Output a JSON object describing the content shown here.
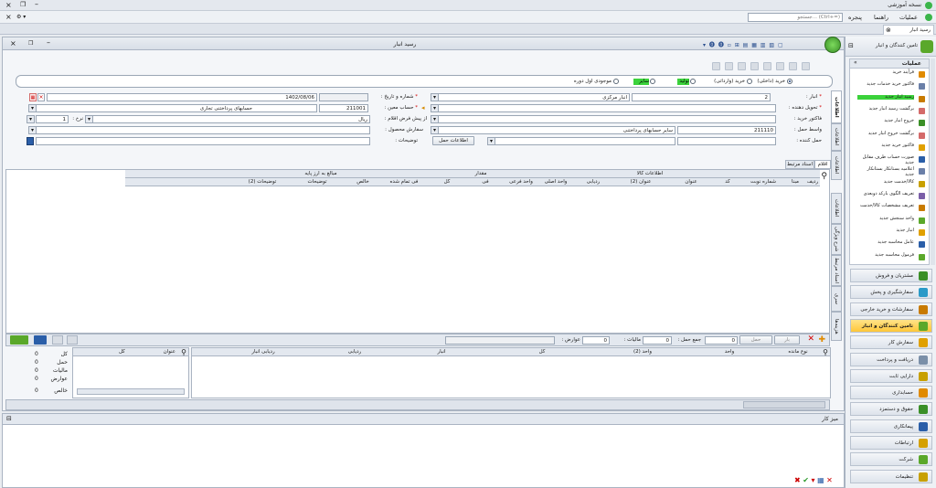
{
  "app": {
    "title": "نسخه آموزشی"
  },
  "menu": {
    "items": [
      "عملیات",
      "راهنما",
      "پنجره"
    ],
    "search_placeholder": "جستجو... (Ctrl+=)"
  },
  "doc_tab": {
    "label": "رسید انبار"
  },
  "window": {
    "title": "رسید انبار"
  },
  "purchase_type": {
    "options": [
      "خرید (داخلی)",
      "خرید (وارداتی)",
      "تولید",
      "سایر",
      "موجودی اول دوره"
    ],
    "selected": "خرید (داخلی)"
  },
  "form": {
    "warehouse_label": "انبار :",
    "warehouse_code": "2",
    "warehouse_name": "انبار مرکزی",
    "number_date_label": "شماره و تاریخ :",
    "date": "1402/08/06",
    "deliverer_label": "تحویل دهنده :",
    "account_label": "حساب معین :",
    "account_code": "211001",
    "account_name": "حسابهای پرداختنی تجاری",
    "purchase_invoice_label": "فاکتور خرید :",
    "rate_label": "نرخ :",
    "rate_value": "1",
    "from_proforma_label": "از پیش فرض اقلام :",
    "currency": "ریال",
    "carrier_label": "واسط حمل :",
    "carrier_code": "211110",
    "carrier_name": "سایر حسابهای پرداختنی",
    "order_label": "سفارش محصول :",
    "shipper_label": "حمل کننده :",
    "description_label": "توضیحات :",
    "shipping_info_button": "اطلاعات حمل"
  },
  "side_tabs": [
    "اطلاعات اصلی",
    "اطلاعات ارزی",
    "اطلاعات تکمیلی",
    "اطلاعات مرجع",
    "شرح ویژگی",
    "اسناد مرتبط",
    "سری ساخت",
    "هزینه‌ها"
  ],
  "items_tabs": [
    "اقلام",
    "اسناد مرتبط"
  ],
  "grid": {
    "group_headers": [
      "اطلاعات کالا",
      "مقدار",
      "مبالغ به ارز پایه"
    ],
    "columns": [
      "ردیف",
      "مبنا",
      "شماره نوبت",
      "کد",
      "عنوان",
      "عنوان (2)",
      "ردیابی",
      "واحد اصلی",
      "واحد فرعی",
      "فی",
      "کل",
      "فی تمام شده",
      "خالص",
      "توضیحات",
      "توضیحات (2)"
    ]
  },
  "footer_bar": {
    "total_label": "جمع حمل :",
    "total_value": "0",
    "tax_label": "مالیات :",
    "tax_value": "0",
    "duties_label": "عوارض :",
    "duties_value": "0",
    "btn_load": "حمل",
    "btn_more": "بار"
  },
  "lower_grid": {
    "columns": [
      "نوع مانده",
      "واحد",
      "واحد (2)",
      "کل",
      "انبار",
      "ردیابی",
      "ردیابی انبار",
      "عنوان",
      "کل"
    ]
  },
  "summary": {
    "rows": [
      {
        "label": "کل",
        "value": "0"
      },
      {
        "label": "حمل",
        "value": "0"
      },
      {
        "label": "مالیات",
        "value": "0"
      },
      {
        "label": "عوارض",
        "value": "0"
      },
      {
        "label": "خالص",
        "value": "0"
      }
    ]
  },
  "workspace": {
    "title": "میز کار"
  },
  "panel": {
    "title": "تامین کنندگان و انبار",
    "ops_title": "عملیات",
    "ops": [
      "فرآیند خرید",
      "فاکتور خرید خدمات جدید",
      "رسید انبار جدید",
      "برگشت رسید انبار جدید",
      "خروج انبار جدید",
      "برگشت خروج انبار جدید",
      "فاکتور خرید جدید",
      "صورت حساب طرف مقابل جدید",
      "اعلامیه بستانکار بستانکار جدید",
      "کالا/خدمت جدید",
      "تعریف الگوی بارکد دوبعدی",
      "تعریف مشخصات کالا/خدمت",
      "واحد سنجش جدید",
      "انبار جدید",
      "عامل محاسبه جدید",
      "فرمول محاسبه جدید"
    ],
    "modules": [
      "مشتریان و فروش",
      "سفارشگیری و پخش",
      "سفارشات و خرید خارجی",
      "تامین کنندگان و انبار",
      "سفارش کار",
      "دریافت و پرداخت",
      "دارایی ثابت",
      "حسابداری",
      "حقوق و دستمزد",
      "پیمانکاری",
      "ارتباطات",
      "شرکت",
      "تنظیمات"
    ],
    "active_module": "تامین کنندگان و انبار"
  },
  "colors": {
    "accent": "#3bd23b",
    "active_module": "#ffc739",
    "required": "#d40000"
  }
}
